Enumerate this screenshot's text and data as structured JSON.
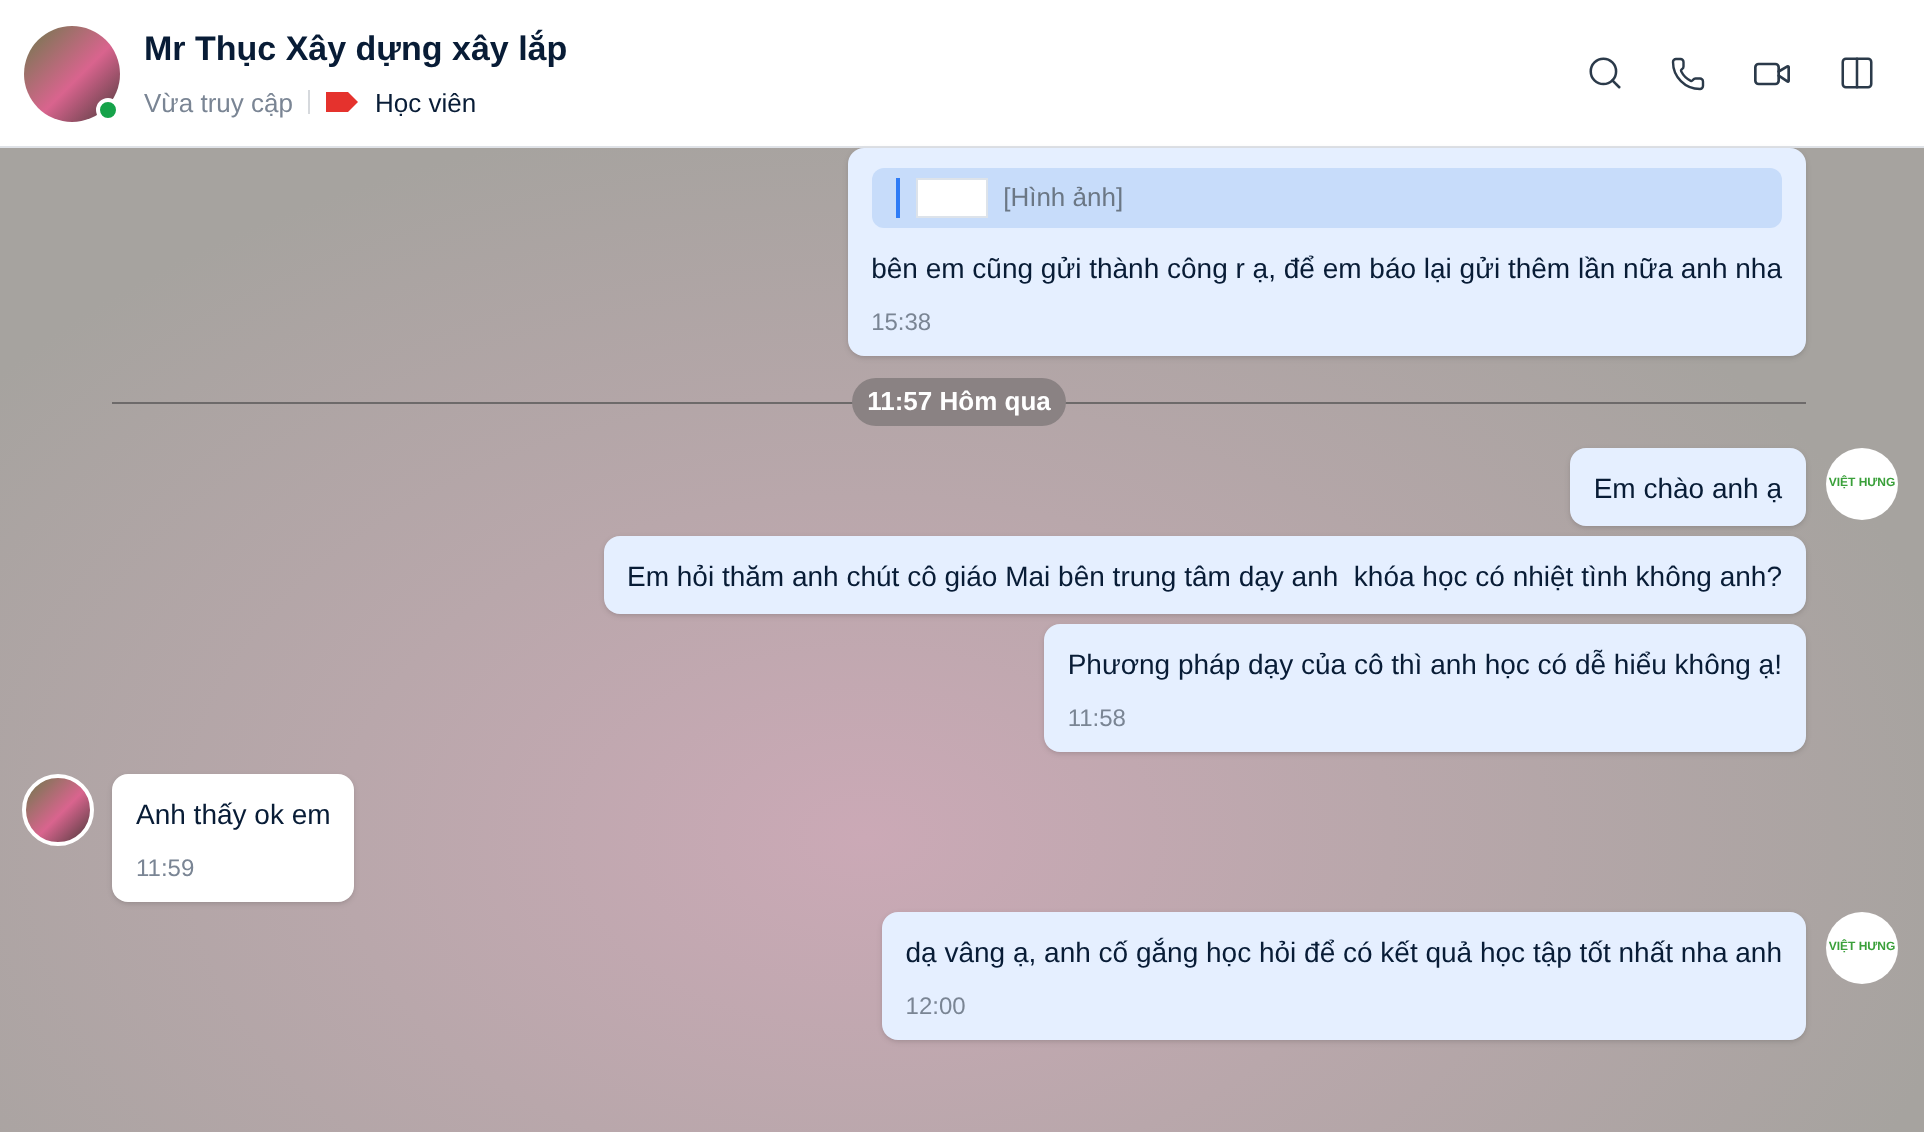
{
  "header": {
    "name": "Mr Thục Xây dựng xây lắp",
    "online": true,
    "status": "Vừa truy cập",
    "tag": {
      "label": "Học viên",
      "color": "#e5322d"
    }
  },
  "messages": [
    {
      "kind": "outgoing",
      "quote": {
        "caption": "[Hình ảnh]"
      },
      "text": "bên em cũng gửi thành công r ạ, để em báo lại gửi thêm lần nữa anh nha",
      "time": "15:38",
      "avatar": false
    },
    {
      "kind": "divider",
      "label": "11:57 Hôm qua"
    },
    {
      "kind": "outgoing",
      "text": "Em chào anh ạ",
      "avatar": true,
      "logo": "VIỆT HƯNG"
    },
    {
      "kind": "outgoing",
      "text": "Em hỏi thăm anh chút cô giáo Mai bên trung tâm dạy anh  khóa học có nhiệt tình không anh?",
      "avatar": false
    },
    {
      "kind": "outgoing",
      "text": "Phương pháp dạy của cô thì anh học có dễ hiểu không ạ!",
      "time": "11:58",
      "avatar": false
    },
    {
      "kind": "incoming",
      "text": "Anh thấy ok em",
      "time": "11:59",
      "avatar": true
    },
    {
      "kind": "outgoing",
      "text": "dạ vâng ạ, anh cố gắng học hỏi để có kết quả học tập tốt nhất nha anh",
      "time": "12:00",
      "avatar": true,
      "logo": "VIỆT HƯNG"
    }
  ]
}
